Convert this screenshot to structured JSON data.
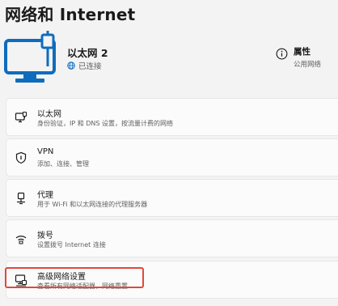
{
  "page": {
    "title": "网络和 Internet"
  },
  "connection": {
    "name": "以太网 2",
    "status": "已连接"
  },
  "properties": {
    "title": "属性",
    "subtitle": "公用网络"
  },
  "items": [
    {
      "title": "以太网",
      "subtitle": "身份验证，IP 和 DNS 设置，按流量计费的网络",
      "icon": "ethernet-icon"
    },
    {
      "title": "VPN",
      "subtitle": "添加、连接、管理",
      "icon": "vpn-shield-icon"
    },
    {
      "title": "代理",
      "subtitle": "用于 Wi-Fi 和以太网连接的代理服务器",
      "icon": "proxy-icon"
    },
    {
      "title": "拨号",
      "subtitle": "设置拨号 Internet 连接",
      "icon": "dialup-icon"
    },
    {
      "title": "高级网络设置",
      "subtitle": "查看所有网络适配器，网络重置",
      "icon": "advanced-network-icon"
    }
  ],
  "colors": {
    "accent": "#0067c0",
    "highlight": "#e0483b",
    "card_bg": "#fbfbfb",
    "page_bg": "#f3f3f3"
  }
}
